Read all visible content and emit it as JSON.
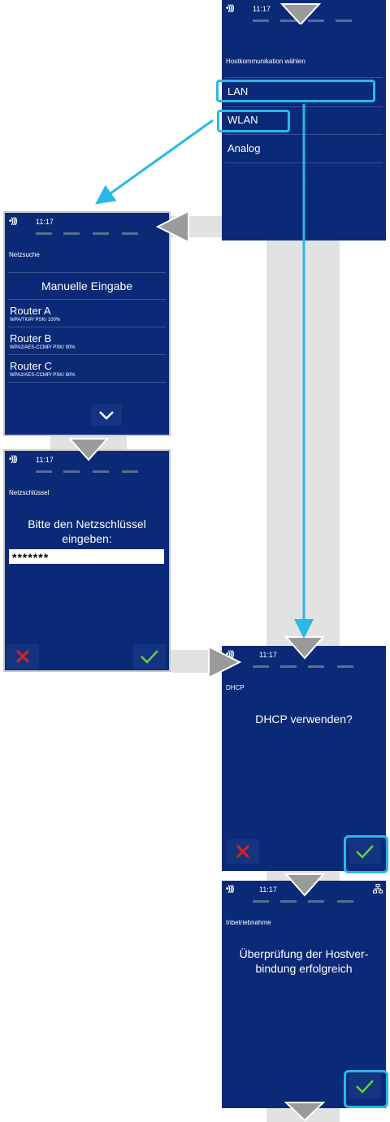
{
  "status": {
    "nfc_icon": "contactless-icon",
    "time": "11:17"
  },
  "screens": {
    "host": {
      "title": "Hostkommunikation wählen",
      "items": [
        "LAN",
        "WLAN",
        "Analog"
      ]
    },
    "netz": {
      "title": "Netzsuche",
      "manual": "Manuelle Eingabe",
      "routers": [
        {
          "name": "Router A",
          "detail": "WPA/TKIP/ PSK/ 100%"
        },
        {
          "name": "Router B",
          "detail": "WPA2/AES-CCMP/ PSK/ 90%"
        },
        {
          "name": "Router C",
          "detail": "WPA2/AES-CCMP/ PSK/ 80%"
        }
      ],
      "more_icon": "chevron-down-icon"
    },
    "key": {
      "title": "Netzschlüssel",
      "prompt_line1": "Bitte den Netzschlüssel",
      "prompt_line2": "eingeben:",
      "value": "*******"
    },
    "dhcp": {
      "title": "DHCP",
      "question": "DHCP verwenden?"
    },
    "inbetrieb": {
      "title": "Inbetriebnahme",
      "line1": "Überprüfung der Hostver-",
      "line2": "bindung erfolgreich",
      "network_icon": "network-icon"
    }
  },
  "colors": {
    "screen_bg": "#0a2a78",
    "highlight": "#2ab8e6",
    "cancel": "#e0201c",
    "confirm": "#5fd23a",
    "arrow_gray": "#9a9a9a",
    "connector_gray": "#e2e2e2"
  }
}
